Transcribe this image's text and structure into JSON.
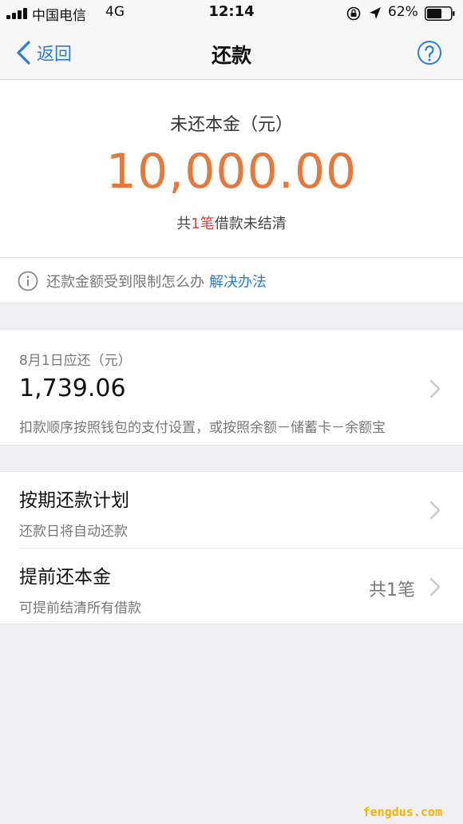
{
  "status_bar": {
    "carrier": "中国电信",
    "network": "4G",
    "time": "12:14",
    "battery_percent": "62%",
    "battery_level": 0.62,
    "icons": [
      "signal-icon",
      "orientation-lock-icon",
      "location-arrow-icon",
      "battery-icon"
    ]
  },
  "nav": {
    "back_label": "返回",
    "title": "还款",
    "icons": [
      "chevron-left-icon",
      "help-icon"
    ]
  },
  "summary": {
    "label": "未还本金（元）",
    "amount": "10,000.00",
    "note_prefix": "共",
    "note_count": "1笔",
    "note_suffix": "借款未结清"
  },
  "info": {
    "text": "还款金额受到限制怎么办",
    "link": "解决办法",
    "icon": "info-icon"
  },
  "due": {
    "label": "8月1日应还（元）",
    "amount": "1,739.06",
    "description": "扣款顺序按照钱包的支付设置，或按照余额－储蓄卡－余额宝"
  },
  "plans": [
    {
      "title": "按期还款计划",
      "subtitle": "还款日将自动还款",
      "count": ""
    },
    {
      "title": "提前还本金",
      "subtitle": "可提前结清所有借款",
      "count": "共1笔"
    }
  ],
  "watermark": "fengdus.com",
  "colors": {
    "accent_blue": "#2a7dd6",
    "amount_orange": "#e7783c",
    "highlight_red": "#e0393e",
    "background": "#efeff4"
  }
}
